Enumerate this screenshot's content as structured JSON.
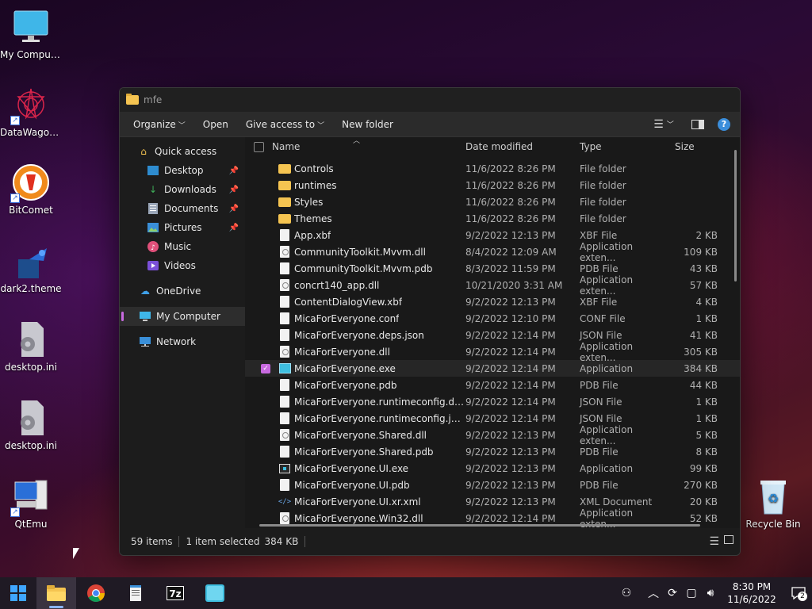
{
  "desktop_icons": [
    {
      "label": "My Computer",
      "icon": "monitor-icon"
    },
    {
      "label": "DataWagon...",
      "icon": "datawagon-icon"
    },
    {
      "label": "BitComet",
      "icon": "bitcomet-icon"
    },
    {
      "label": "dark2.theme",
      "icon": "theme-file-icon"
    },
    {
      "label": "desktop.ini",
      "icon": "settings-file-icon"
    },
    {
      "label": "desktop.ini",
      "icon": "settings-file-icon"
    },
    {
      "label": "QtEmu",
      "icon": "qtemu-icon"
    },
    {
      "label": "Recycle Bin",
      "icon": "recycle-bin-icon"
    }
  ],
  "window": {
    "title": "mfe",
    "commands": {
      "organize": "Organize",
      "open": "Open",
      "give_access": "Give access to",
      "new_folder": "New folder"
    }
  },
  "nav": {
    "quick_access": "Quick access",
    "items": [
      {
        "label": "Desktop",
        "pinned": true
      },
      {
        "label": "Downloads",
        "pinned": true
      },
      {
        "label": "Documents",
        "pinned": true
      },
      {
        "label": "Pictures",
        "pinned": true
      },
      {
        "label": "Music",
        "pinned": false
      },
      {
        "label": "Videos",
        "pinned": false
      }
    ],
    "onedrive": "OneDrive",
    "my_computer": "My Computer",
    "network": "Network"
  },
  "columns": {
    "name": "Name",
    "date": "Date modified",
    "type": "Type",
    "size": "Size"
  },
  "files": [
    {
      "name": "Controls",
      "date": "11/6/2022 8:26 PM",
      "type": "File folder",
      "size": "",
      "icon": "folder"
    },
    {
      "name": "runtimes",
      "date": "11/6/2022 8:26 PM",
      "type": "File folder",
      "size": "",
      "icon": "folder"
    },
    {
      "name": "Styles",
      "date": "11/6/2022 8:26 PM",
      "type": "File folder",
      "size": "",
      "icon": "folder"
    },
    {
      "name": "Themes",
      "date": "11/6/2022 8:26 PM",
      "type": "File folder",
      "size": "",
      "icon": "folder"
    },
    {
      "name": "App.xbf",
      "date": "9/2/2022 12:13 PM",
      "type": "XBF File",
      "size": "2 KB",
      "icon": "doc"
    },
    {
      "name": "CommunityToolkit.Mvvm.dll",
      "date": "8/4/2022 12:09 AM",
      "type": "Application exten...",
      "size": "109 KB",
      "icon": "dll"
    },
    {
      "name": "CommunityToolkit.Mvvm.pdb",
      "date": "8/3/2022 11:59 PM",
      "type": "PDB File",
      "size": "43 KB",
      "icon": "doc"
    },
    {
      "name": "concrt140_app.dll",
      "date": "10/21/2020 3:31 AM",
      "type": "Application exten...",
      "size": "57 KB",
      "icon": "dll"
    },
    {
      "name": "ContentDialogView.xbf",
      "date": "9/2/2022 12:13 PM",
      "type": "XBF File",
      "size": "4 KB",
      "icon": "doc"
    },
    {
      "name": "MicaForEveryone.conf",
      "date": "9/2/2022 12:10 PM",
      "type": "CONF File",
      "size": "1 KB",
      "icon": "doc"
    },
    {
      "name": "MicaForEveryone.deps.json",
      "date": "9/2/2022 12:14 PM",
      "type": "JSON File",
      "size": "41 KB",
      "icon": "doc"
    },
    {
      "name": "MicaForEveryone.dll",
      "date": "9/2/2022 12:14 PM",
      "type": "Application exten...",
      "size": "305 KB",
      "icon": "dll"
    },
    {
      "name": "MicaForEveryone.exe",
      "date": "9/2/2022 12:14 PM",
      "type": "Application",
      "size": "384 KB",
      "icon": "app",
      "selected": true
    },
    {
      "name": "MicaForEveryone.pdb",
      "date": "9/2/2022 12:14 PM",
      "type": "PDB File",
      "size": "44 KB",
      "icon": "doc"
    },
    {
      "name": "MicaForEveryone.runtimeconfig.dev.j...",
      "date": "9/2/2022 12:14 PM",
      "type": "JSON File",
      "size": "1 KB",
      "icon": "doc"
    },
    {
      "name": "MicaForEveryone.runtimeconfig.json",
      "date": "9/2/2022 12:14 PM",
      "type": "JSON File",
      "size": "1 KB",
      "icon": "doc"
    },
    {
      "name": "MicaForEveryone.Shared.dll",
      "date": "9/2/2022 12:13 PM",
      "type": "Application exten...",
      "size": "5 KB",
      "icon": "dll"
    },
    {
      "name": "MicaForEveryone.Shared.pdb",
      "date": "9/2/2022 12:13 PM",
      "type": "PDB File",
      "size": "8 KB",
      "icon": "doc"
    },
    {
      "name": "MicaForEveryone.UI.exe",
      "date": "9/2/2022 12:13 PM",
      "type": "Application",
      "size": "99 KB",
      "icon": "appsm"
    },
    {
      "name": "MicaForEveryone.UI.pdb",
      "date": "9/2/2022 12:13 PM",
      "type": "PDB File",
      "size": "270 KB",
      "icon": "doc"
    },
    {
      "name": "MicaForEveryone.UI.xr.xml",
      "date": "9/2/2022 12:13 PM",
      "type": "XML Document",
      "size": "20 KB",
      "icon": "xml"
    },
    {
      "name": "MicaForEveryone.Win32.dll",
      "date": "9/2/2022 12:14 PM",
      "type": "Application exten...",
      "size": "52 KB",
      "icon": "dll"
    }
  ],
  "status": {
    "items": "59 items",
    "selected": "1 item selected",
    "size": "384 KB"
  },
  "taskbar": {
    "apps": [
      "start-icon",
      "file-explorer-icon",
      "chrome-icon",
      "notepad-icon",
      "7zip-icon",
      "mica-app-icon"
    ],
    "time": "8:30 PM",
    "date": "11/6/2022",
    "notifications": "2"
  }
}
